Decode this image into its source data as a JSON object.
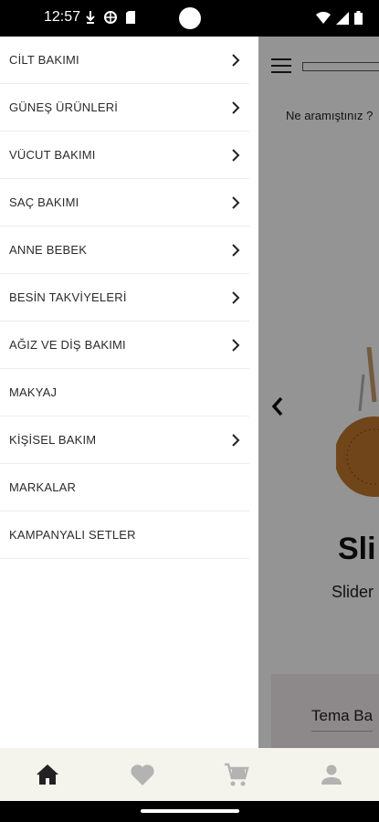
{
  "status_bar": {
    "time": "12:57"
  },
  "background": {
    "search_placeholder": "Ne aramıştınız ?",
    "slide_title": "Sli",
    "slide_subtitle": "Slider",
    "theme_card_title": "Tema Ba"
  },
  "drawer": {
    "items": [
      {
        "label": "CİLT BAKIMI",
        "has_children": true
      },
      {
        "label": "GÜNEŞ ÜRÜNLERİ",
        "has_children": true
      },
      {
        "label": "VÜCUT BAKIMI",
        "has_children": true
      },
      {
        "label": "SAÇ BAKIMI",
        "has_children": true
      },
      {
        "label": "ANNE BEBEK",
        "has_children": true
      },
      {
        "label": "BESİN TAKVİYELERİ",
        "has_children": true
      },
      {
        "label": "AĞIZ VE DİŞ BAKIMI",
        "has_children": true
      },
      {
        "label": "MAKYAJ",
        "has_children": false
      },
      {
        "label": "KİŞİSEL BAKIM",
        "has_children": true
      },
      {
        "label": "MARKALAR",
        "has_children": false
      },
      {
        "label": "KAMPANYALI SETLER",
        "has_children": false
      }
    ]
  },
  "bottom_nav": {
    "items": [
      "home-icon",
      "heart-icon",
      "cart-icon",
      "user-icon"
    ],
    "active": "home-icon"
  },
  "colors": {
    "nav_bg": "#f4f4ec",
    "active_icon": "#222222",
    "inactive_icon": "#b3b3b3"
  }
}
